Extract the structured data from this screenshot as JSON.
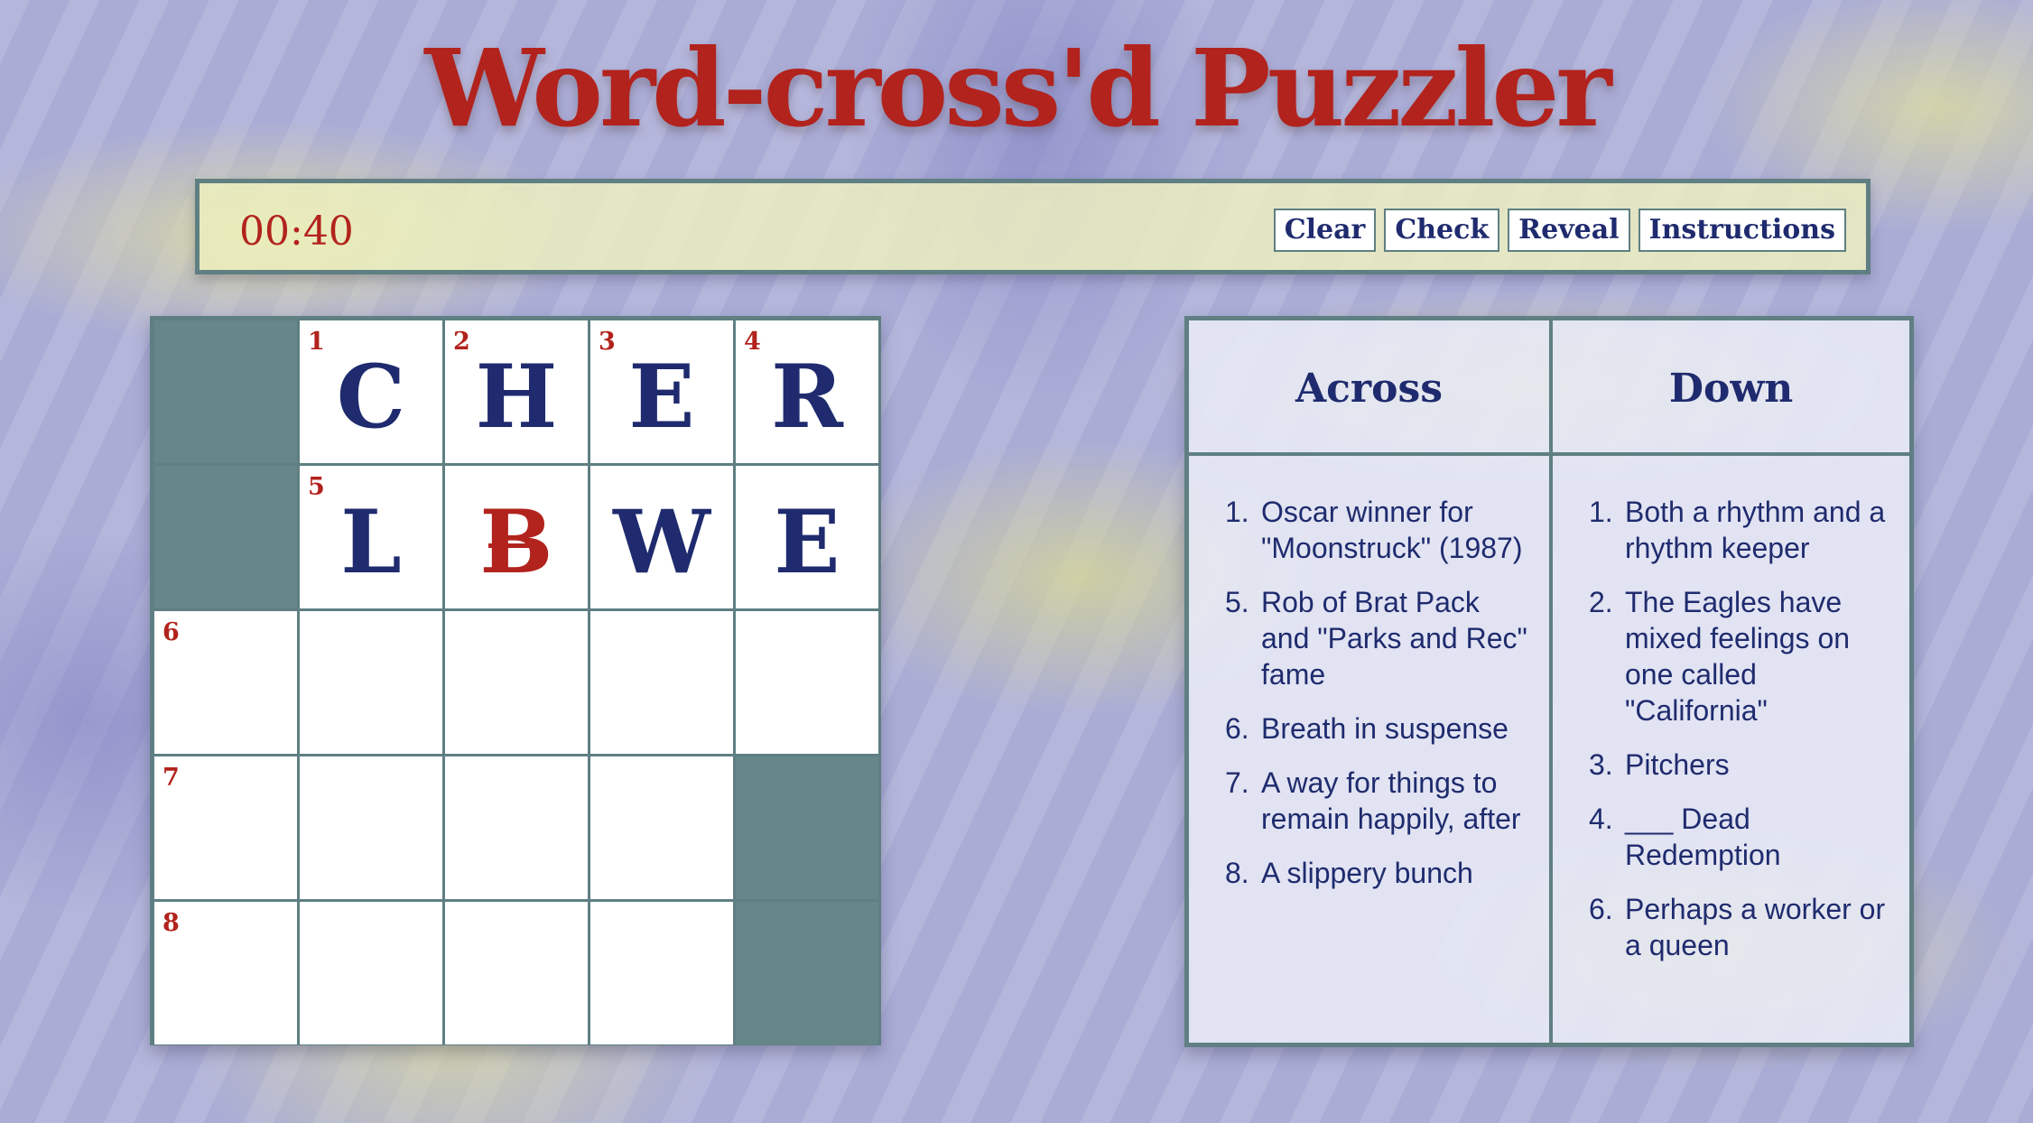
{
  "title": "Word-cross'd Puzzler",
  "toolbar": {
    "timer": "00:40",
    "buttons": {
      "clear": "Clear",
      "check": "Check",
      "reveal": "Reveal",
      "instructions": "Instructions"
    }
  },
  "grid": {
    "rows": [
      [
        {
          "black": true
        },
        {
          "num": "1",
          "letter": "C"
        },
        {
          "num": "2",
          "letter": "H"
        },
        {
          "num": "3",
          "letter": "E"
        },
        {
          "num": "4",
          "letter": "R"
        }
      ],
      [
        {
          "black": true
        },
        {
          "num": "5",
          "letter": "L"
        },
        {
          "letter": "B",
          "incorrect": true
        },
        {
          "letter": "W"
        },
        {
          "letter": "E"
        }
      ],
      [
        {
          "num": "6"
        },
        {},
        {},
        {},
        {}
      ],
      [
        {
          "num": "7"
        },
        {},
        {},
        {},
        {
          "black": true
        }
      ],
      [
        {
          "num": "8"
        },
        {},
        {},
        {},
        {
          "black": true
        }
      ]
    ]
  },
  "clues": {
    "across_title": "Across",
    "down_title": "Down",
    "across": [
      {
        "n": "1.",
        "text": "Oscar winner for \"Moonstruck\" (1987)"
      },
      {
        "n": "5.",
        "text": "Rob of Brat Pack and \"Parks and Rec\" fame"
      },
      {
        "n": "6.",
        "text": "Breath in suspense"
      },
      {
        "n": "7.",
        "text": "A way for things to remain happily, after"
      },
      {
        "n": "8.",
        "text": "A slippery bunch"
      }
    ],
    "down": [
      {
        "n": "1.",
        "text": "Both a rhythm and a rhythm keeper"
      },
      {
        "n": "2.",
        "text": "The Eagles have mixed feelings on one called \"California\""
      },
      {
        "n": "3.",
        "text": "Pitchers"
      },
      {
        "n": "4.",
        "text": "___ Dead Redemption"
      },
      {
        "n": "6.",
        "text": "Perhaps a worker or a queen"
      }
    ]
  },
  "colors": {
    "accent_red": "#b2231d",
    "navy": "#1f2b6e",
    "teal_border": "#5f7f82",
    "block": "#65878a"
  }
}
